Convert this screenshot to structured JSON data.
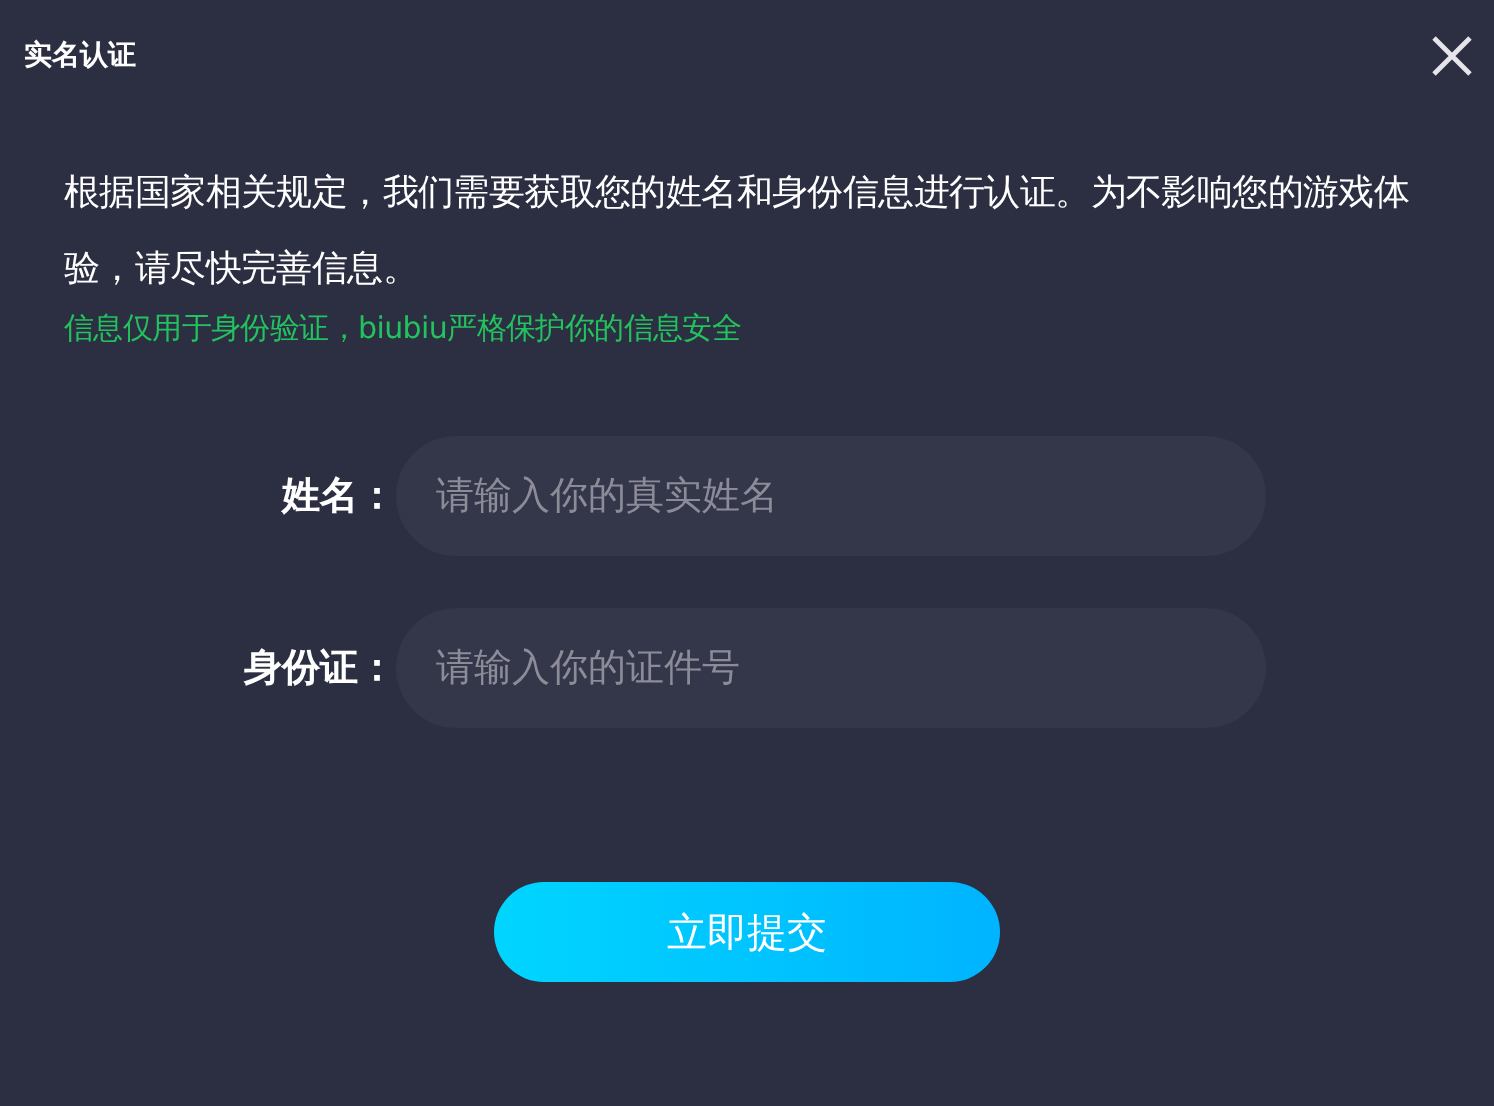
{
  "window": {
    "title": "实名认证"
  },
  "notice": "根据国家相关规定，我们需要获取您的姓名和身份信息进行认证。为不影响您的游戏体验，请尽快完善信息。",
  "privacy_note": "信息仅用于身份验证，biubiu严格保护你的信息安全",
  "fields": [
    {
      "label": "姓名：",
      "placeholder": "请输入你的真实姓名"
    },
    {
      "label": "身份证：",
      "placeholder": "请输入你的证件号"
    }
  ],
  "submit_button": "立即提交"
}
